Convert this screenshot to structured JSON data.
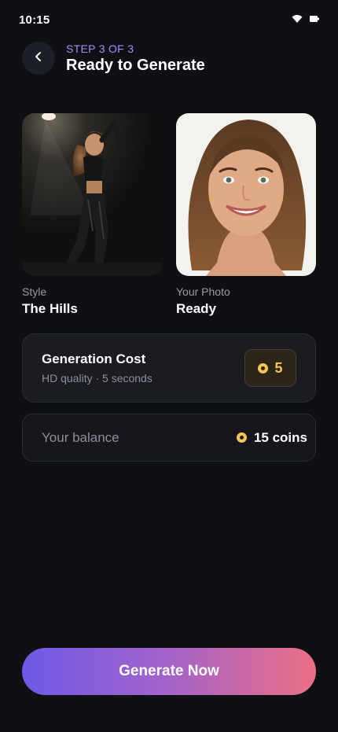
{
  "status_bar": {
    "time": "10:15"
  },
  "header": {
    "step": "STEP 3 OF 3",
    "title": "Ready to Generate"
  },
  "style_card": {
    "caption": "Style",
    "value": "The Hills"
  },
  "photo_card": {
    "caption": "Your Photo",
    "value": "Ready"
  },
  "cost": {
    "title": "Generation Cost",
    "subtitle": "HD quality · 5 seconds",
    "amount": "5"
  },
  "balance": {
    "label": "Your balance",
    "value": "15 coins"
  },
  "cta": {
    "label": "Generate Now"
  },
  "colors": {
    "accent": "#a78bfa",
    "coin": "#f5c453",
    "cta_start": "#6d5ae6",
    "cta_end": "#ec6f84"
  },
  "icons": [
    "chevron-left-icon",
    "wifi-icon",
    "battery-icon",
    "coin-icon"
  ]
}
